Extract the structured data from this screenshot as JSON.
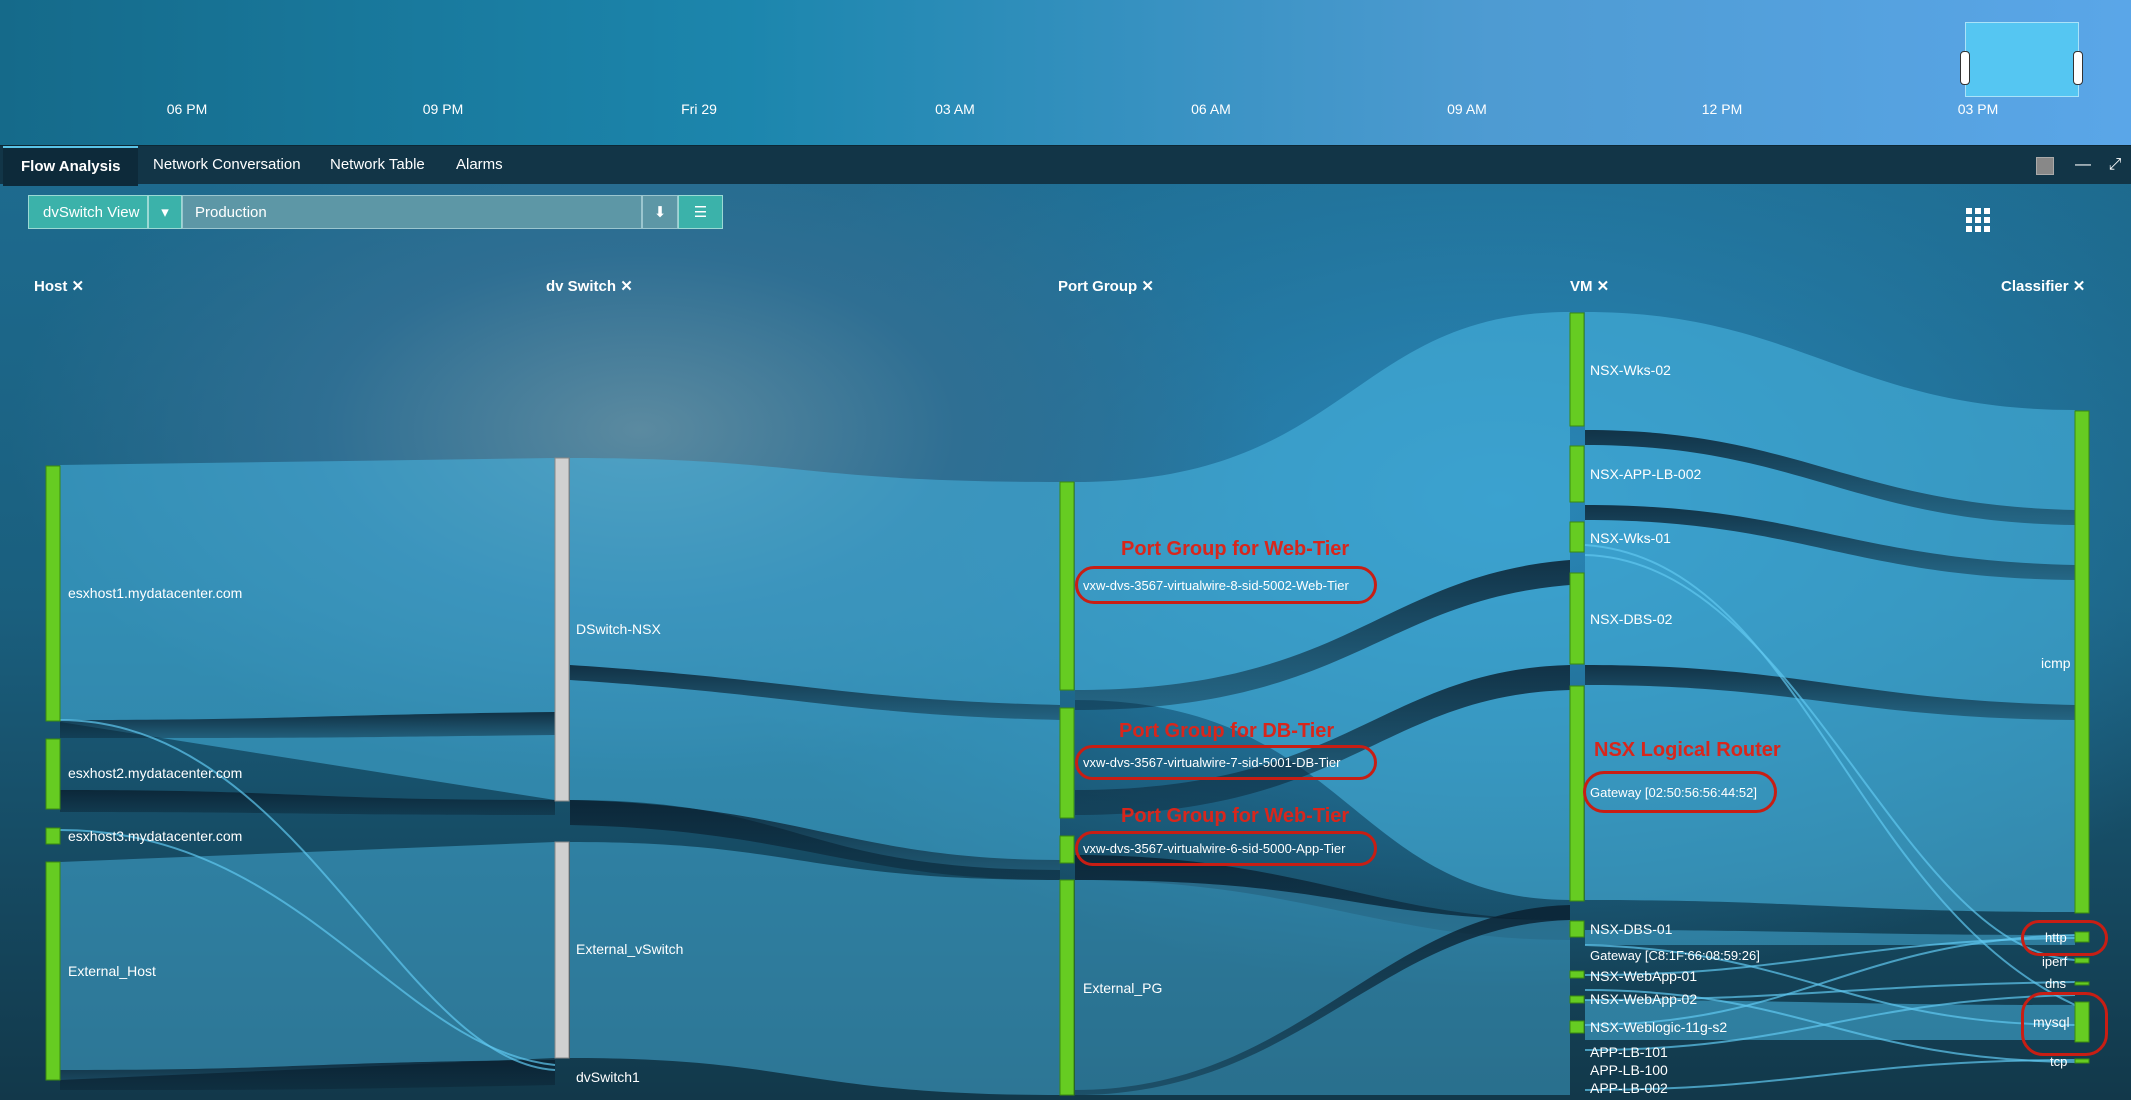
{
  "timeline": {
    "ticks": [
      "06 PM",
      "09 PM",
      "Fri 29",
      "03 AM",
      "06 AM",
      "09 AM",
      "12 PM",
      "03 PM"
    ]
  },
  "tabs": [
    {
      "label": "Flow Analysis",
      "active": true
    },
    {
      "label": "Network Conversation",
      "active": false
    },
    {
      "label": "Network Table",
      "active": false
    },
    {
      "label": "Alarms",
      "active": false
    }
  ],
  "controls": {
    "view_label": "dvSwitch View",
    "filter_value": "Production"
  },
  "columns": {
    "host": "Host",
    "dvswitch": "dv Switch",
    "portgroup": "Port Group",
    "vm": "VM",
    "classifier": "Classifier"
  },
  "nodes": {
    "host": [
      "esxhost1.mydatacenter.com",
      "esxhost2.mydatacenter.com",
      "esxhost3.mydatacenter.com",
      "External_Host"
    ],
    "dvswitch": [
      "DSwitch-NSX",
      "External_vSwitch",
      "dvSwitch1"
    ],
    "portgroup": [
      "vxw-dvs-3567-virtualwire-8-sid-5002-Web-Tier",
      "vxw-dvs-3567-virtualwire-7-sid-5001-DB-Tier",
      "vxw-dvs-3567-virtualwire-6-sid-5000-App-Tier",
      "External_PG"
    ],
    "vm": [
      "NSX-Wks-02",
      "NSX-APP-LB-002",
      "NSX-Wks-01",
      "NSX-DBS-02",
      "Gateway [02:50:56:56:44:52]",
      "NSX-DBS-01",
      "Gateway [C8:1F:66:08:59:26]",
      "NSX-WebApp-01",
      "NSX-WebApp-02",
      "NSX-Weblogic-11g-s2",
      "APP-LB-101",
      "APP-LB-100",
      "APP-LB-002"
    ],
    "classifier": [
      "icmp",
      "http",
      "iperf",
      "dns",
      "mysql",
      "tcp"
    ]
  },
  "annotations": {
    "web_tier": "Port Group for Web-Tier",
    "db_tier": "Port Group for DB-Tier",
    "app_tier": "Port Group for Web-Tier",
    "router": "NSX Logical Router"
  },
  "colors": {
    "node_green": "#66cc22",
    "switch_gray": "#d0d0d0",
    "flow": "#47b4e0",
    "annotation": "#d8261c"
  }
}
